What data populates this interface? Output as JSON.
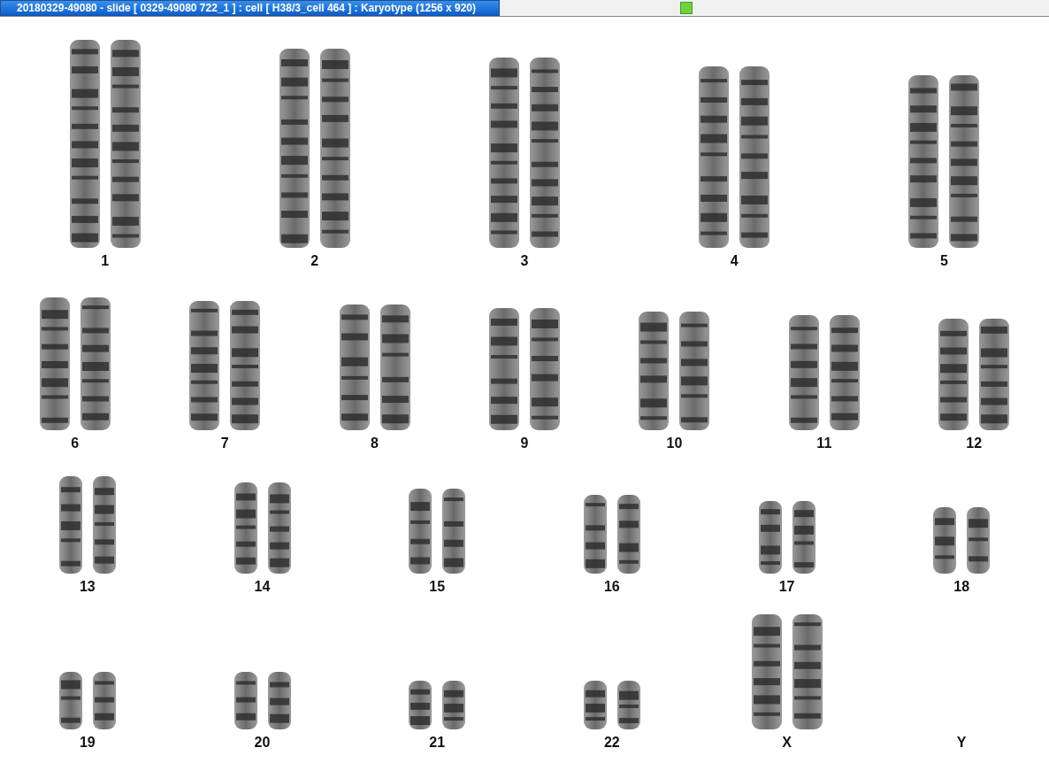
{
  "window": {
    "title": "20180329-49080 - slide [ 0329-49080 722_1 ] : cell [ H38/3_cell 464 ] : Karyotype  (1256 x 920)"
  },
  "karyotype": {
    "rows": [
      {
        "items": [
          {
            "label": "1",
            "kind": "pair"
          },
          {
            "label": "2",
            "kind": "pair"
          },
          {
            "label": "3",
            "kind": "pair"
          },
          {
            "label": "4",
            "kind": "pair"
          },
          {
            "label": "5",
            "kind": "pair"
          }
        ]
      },
      {
        "items": [
          {
            "label": "6",
            "kind": "pair"
          },
          {
            "label": "7",
            "kind": "pair"
          },
          {
            "label": "8",
            "kind": "pair"
          },
          {
            "label": "9",
            "kind": "pair"
          },
          {
            "label": "10",
            "kind": "pair"
          },
          {
            "label": "11",
            "kind": "pair"
          },
          {
            "label": "12",
            "kind": "pair"
          }
        ]
      },
      {
        "items": [
          {
            "label": "13",
            "kind": "pair"
          },
          {
            "label": "14",
            "kind": "pair"
          },
          {
            "label": "15",
            "kind": "pair"
          },
          {
            "label": "16",
            "kind": "pair"
          },
          {
            "label": "17",
            "kind": "pair"
          },
          {
            "label": "18",
            "kind": "pair"
          }
        ]
      },
      {
        "items": [
          {
            "label": "19",
            "kind": "pair"
          },
          {
            "label": "20",
            "kind": "pair"
          },
          {
            "label": "21",
            "kind": "pair"
          },
          {
            "label": "22",
            "kind": "pair"
          },
          {
            "label": "X",
            "kind": "pair"
          },
          {
            "label": "Y",
            "kind": "empty"
          }
        ]
      }
    ]
  }
}
